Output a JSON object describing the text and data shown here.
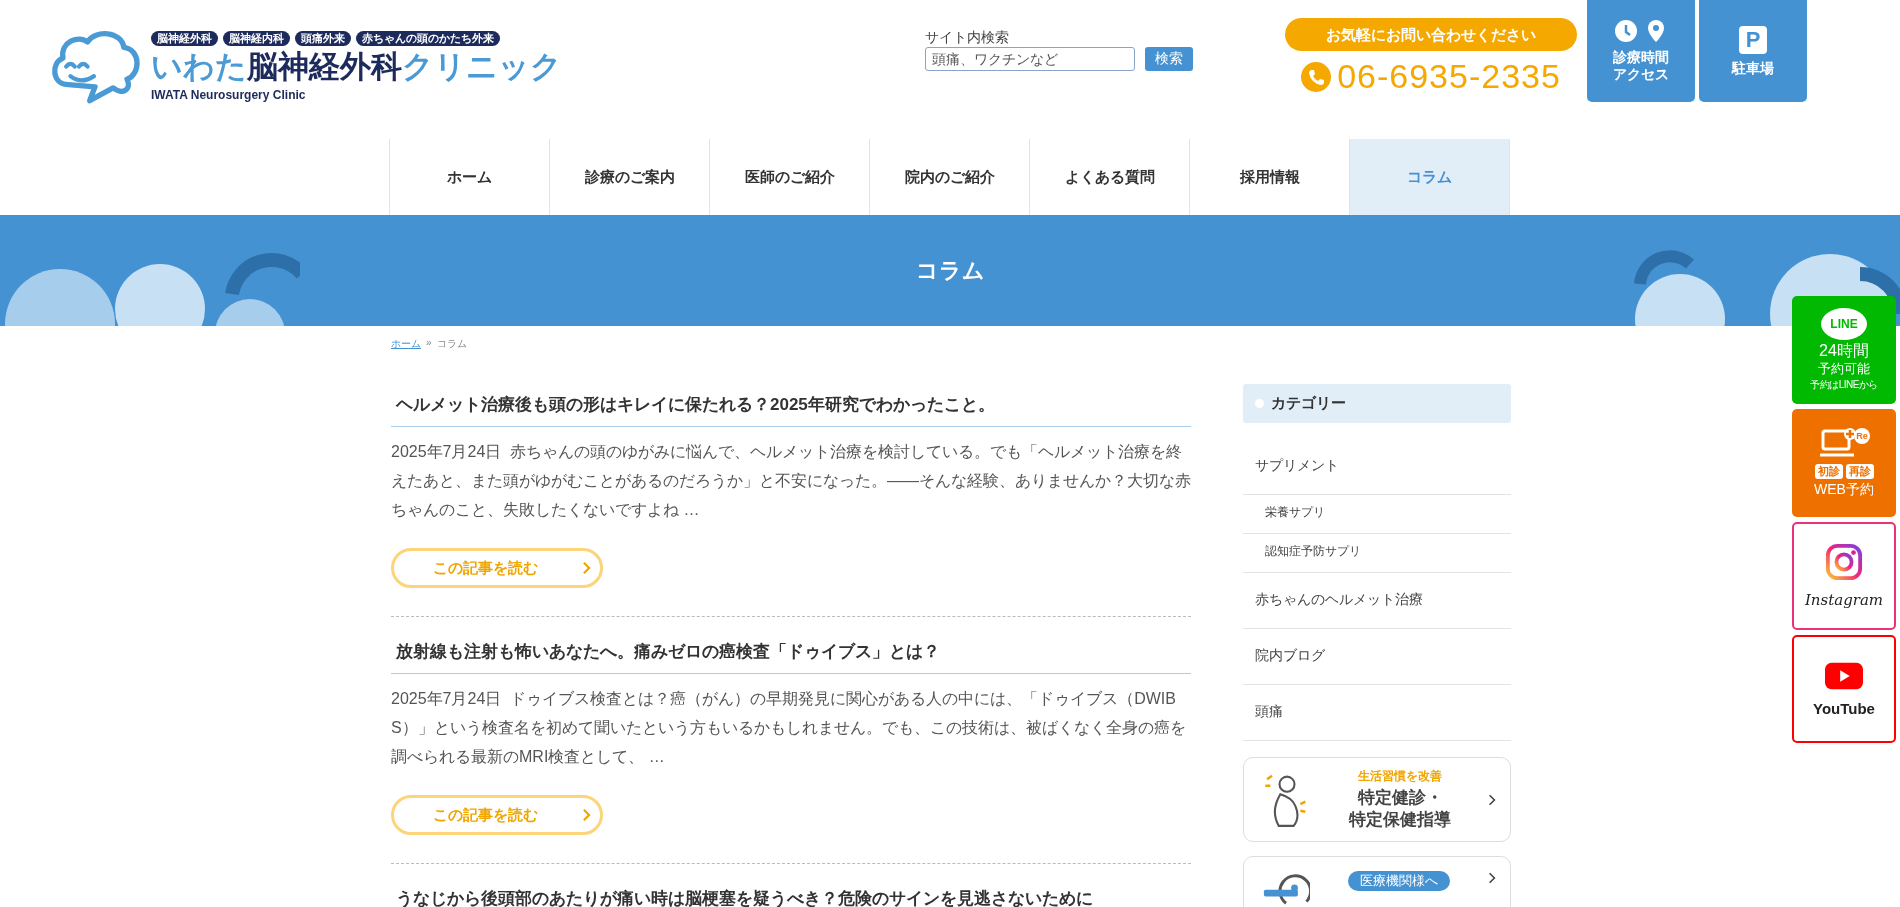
{
  "header": {
    "tags": [
      "脳神経外科",
      "脳神経内科",
      "頭痛外来",
      "赤ちゃんの頭のかたち外来"
    ],
    "logo": {
      "name_prefix": "いわた",
      "name_main": "脳神経外科",
      "name_suffix": "クリニック",
      "english": "IWATA Neurosurgery Clinic"
    },
    "search": {
      "label": "サイト内検索",
      "placeholder": "頭痛、ワクチンなど",
      "button": "検索"
    },
    "contact": {
      "label": "お気軽にお問い合わせください",
      "phone": "06-6935-2335"
    },
    "quick_links": [
      {
        "kind": "access",
        "lines": [
          "診療時間",
          "アクセス"
        ]
      },
      {
        "kind": "parking",
        "icon_text": "P",
        "lines": [
          "駐車場"
        ]
      }
    ]
  },
  "nav": [
    {
      "label": "ホーム",
      "selected": false
    },
    {
      "label": "診療のご案内",
      "selected": false
    },
    {
      "label": "医師のご紹介",
      "selected": false
    },
    {
      "label": "院内のご紹介",
      "selected": false
    },
    {
      "label": "よくある質問",
      "selected": false
    },
    {
      "label": "採用情報",
      "selected": false
    },
    {
      "label": "コラム",
      "selected": true
    }
  ],
  "banner": {
    "title": "コラム"
  },
  "breadcrumb": {
    "home": "ホーム",
    "separator": "»",
    "current": "コラム"
  },
  "articles": [
    {
      "title": "ヘルメット治療後も頭の形はキレイに保たれる？2025年研究でわかったこと。",
      "date": "2025年7月24日",
      "excerpt": "赤ちゃんの頭のゆがみに悩んで、ヘルメット治療を検討している。でも「ヘルメット治療を終えたあと、また頭がゆがむことがあるのだろうか」と不安になった。——そんな経験、ありませんか？大切な赤ちゃんのこと、失敗したくないですよね …",
      "button": "この記事を読む"
    },
    {
      "title": "放射線も注射も怖いあなたへ。痛みゼロの癌検査「ドゥイブス」とは？",
      "date": "2025年7月24日",
      "excerpt": "ドゥイブス検査とは？癌（がん）の早期発見に関心がある人の中には、「ドゥイブス（DWIBS）」という検査名を初めて聞いたという方もいるかもしれません。でも、この技術は、被ばくなく全身の癌を調べられる最新のMRI検査として、 …",
      "button": "この記事を読む"
    },
    {
      "title": "うなじから後頭部のあたりが痛い時は脳梗塞を疑うべき？危険のサインを見逃さないために"
    }
  ],
  "sidebar": {
    "heading": "カテゴリー",
    "categories": [
      {
        "label": "サプリメント",
        "children": [
          {
            "label": "栄養サプリ"
          },
          {
            "label": "認知症予防サプリ"
          }
        ]
      },
      {
        "label": "赤ちゃんのヘルメット治療"
      },
      {
        "label": "院内ブログ"
      },
      {
        "label": "頭痛"
      }
    ],
    "cards": [
      {
        "kind": "checkup",
        "tagline": "生活習慣を改善",
        "title_lines": [
          "特定健診・",
          "特定保健指導"
        ]
      },
      {
        "kind": "mri",
        "badge": "医療機関様へ"
      }
    ]
  },
  "float_buttons": [
    {
      "kind": "line",
      "badge": "LINE",
      "lines": [
        "24時間",
        "予約可能",
        "予約はLINEから"
      ]
    },
    {
      "kind": "web",
      "badge": "Re",
      "tags": [
        "初診",
        "再診"
      ],
      "label": "WEB予約"
    },
    {
      "kind": "instagram",
      "label": "Instagram"
    },
    {
      "kind": "youtube",
      "label": "YouTube"
    }
  ]
}
